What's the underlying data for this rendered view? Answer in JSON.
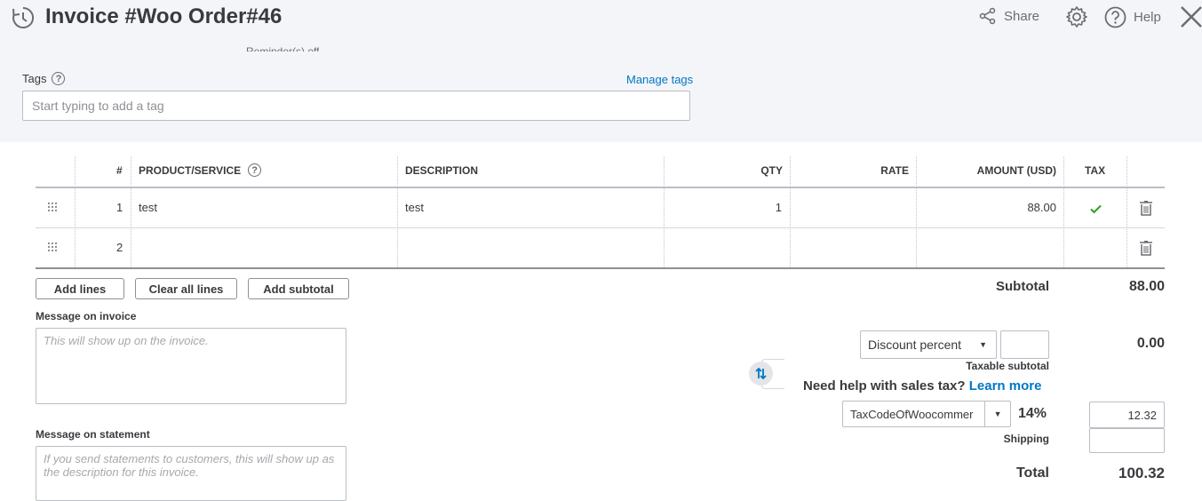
{
  "header": {
    "title": "Invoice #Woo Order#46",
    "share_label": "Share",
    "help_label": "Help",
    "reminder_text": "Reminder(s) off"
  },
  "tags": {
    "label": "Tags",
    "manage_label": "Manage tags",
    "placeholder": "Start typing to add a tag"
  },
  "table": {
    "columns": [
      "#",
      "PRODUCT/SERVICE",
      "DESCRIPTION",
      "QTY",
      "RATE",
      "AMOUNT (USD)",
      "TAX"
    ],
    "rows": [
      {
        "num": "1",
        "product": "test",
        "description": "test",
        "qty": "1",
        "rate": "",
        "amount": "88.00",
        "tax": true
      },
      {
        "num": "2",
        "product": "",
        "description": "",
        "qty": "",
        "rate": "",
        "amount": "",
        "tax": false
      }
    ]
  },
  "buttons": {
    "add_lines": "Add lines",
    "clear_all_lines": "Clear all lines",
    "add_subtotal": "Add subtotal"
  },
  "message_invoice": {
    "label": "Message on invoice",
    "placeholder": "This will show up on the invoice."
  },
  "message_statement": {
    "label": "Message on statement",
    "placeholder": "If you send statements to customers, this will show up as the description for this invoice."
  },
  "totals": {
    "subtotal_label": "Subtotal",
    "subtotal_value": "88.00",
    "discount_type": "Discount percent",
    "discount_input": "",
    "discount_value": "0.00",
    "taxable_subtotal_label": "Taxable subtotal",
    "sales_tax_help": "Need help with sales tax?",
    "learn_more": "Learn more",
    "tax_code": "TaxCodeOfWoocommer",
    "tax_rate": "14%",
    "tax_amount": "12.32",
    "shipping_label": "Shipping",
    "shipping_value": "",
    "total_label": "Total",
    "total_value": "100.32"
  },
  "colors": {
    "link": "#0077c5",
    "tax_check": "#2ca01c",
    "header_bg": "#f4f5f8"
  }
}
